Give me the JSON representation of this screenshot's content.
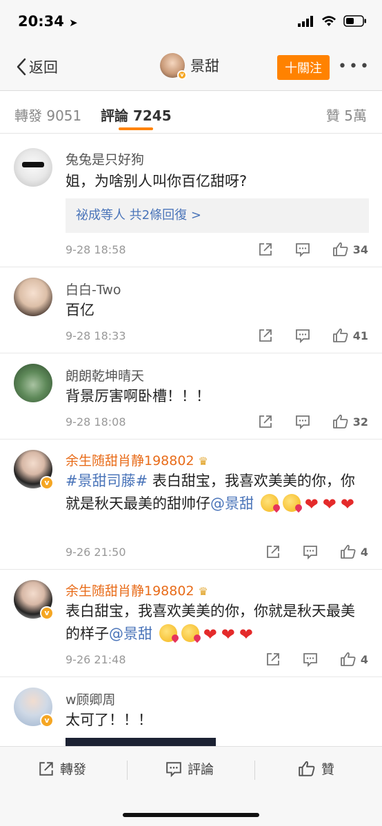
{
  "status": {
    "time": "20:34"
  },
  "nav": {
    "back_label": "返回",
    "username": "景甜",
    "follow_label": "十關注",
    "more_label": "•••"
  },
  "tabs": {
    "repost": "轉發 9051",
    "comment": "評論 7245",
    "like": "贊 5萬"
  },
  "comments": [
    {
      "name": "兔兔是只好狗",
      "text": "姐，为啥别人叫你百亿甜呀?",
      "reply_names": "祕成等人",
      "reply_count": "共2條回復 >",
      "time": "9-28 18:58",
      "likes": "34"
    },
    {
      "name": "白白-Two",
      "text": "百亿",
      "time": "9-28 18:33",
      "likes": "41"
    },
    {
      "name": "朗朗乾坤晴天",
      "text": "背景厉害啊卧槽！！！",
      "time": "9-28 18:08",
      "likes": "32"
    },
    {
      "name": "余生随甜肖静198802",
      "tag": "#景甜司藤#",
      "text_a": " 表白甜宝，我喜欢美美的你，你就是秋天最美的甜帅仔",
      "mention": "@景甜",
      "time": "9-26 21:50",
      "likes": "4"
    },
    {
      "name": "余生随甜肖静198802",
      "text_a": "表白甜宝，我喜欢美美的你，你就是秋天最美的样子",
      "mention": "@景甜",
      "time": "9-26 21:48",
      "likes": "4"
    },
    {
      "name": "w顾卿周",
      "text": "太可了！！！"
    }
  ],
  "bottom": {
    "repost": "轉發",
    "comment": "評論",
    "like": "贊"
  },
  "colors": {
    "accent": "#ff8200",
    "link": "#4a74b9",
    "vip_name": "#e86c1a"
  }
}
